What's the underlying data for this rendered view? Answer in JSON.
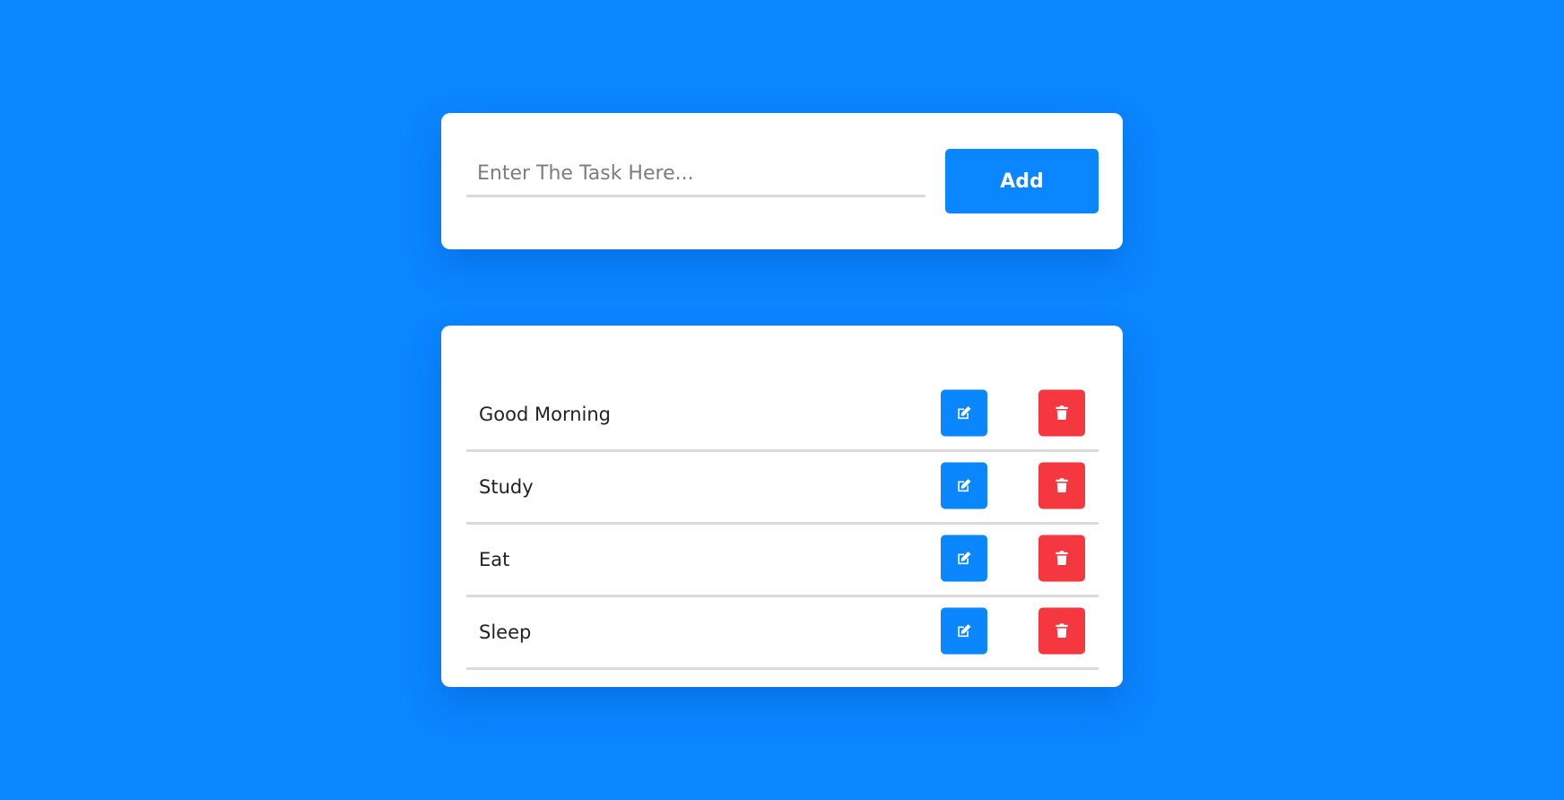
{
  "colors": {
    "background": "#0a86ff",
    "card": "#ffffff",
    "primary": "#0a86ff",
    "danger": "#f5373f",
    "divider": "#dadada"
  },
  "input_card": {
    "task_input": {
      "value": "",
      "placeholder": "Enter The Task Here..."
    },
    "add_label": "Add"
  },
  "tasks": [
    {
      "text": "Good Morning",
      "edit_icon": "edit-icon",
      "delete_icon": "trash-icon"
    },
    {
      "text": "Study",
      "edit_icon": "edit-icon",
      "delete_icon": "trash-icon"
    },
    {
      "text": "Eat",
      "edit_icon": "edit-icon",
      "delete_icon": "trash-icon"
    },
    {
      "text": "Sleep",
      "edit_icon": "edit-icon",
      "delete_icon": "trash-icon"
    }
  ]
}
